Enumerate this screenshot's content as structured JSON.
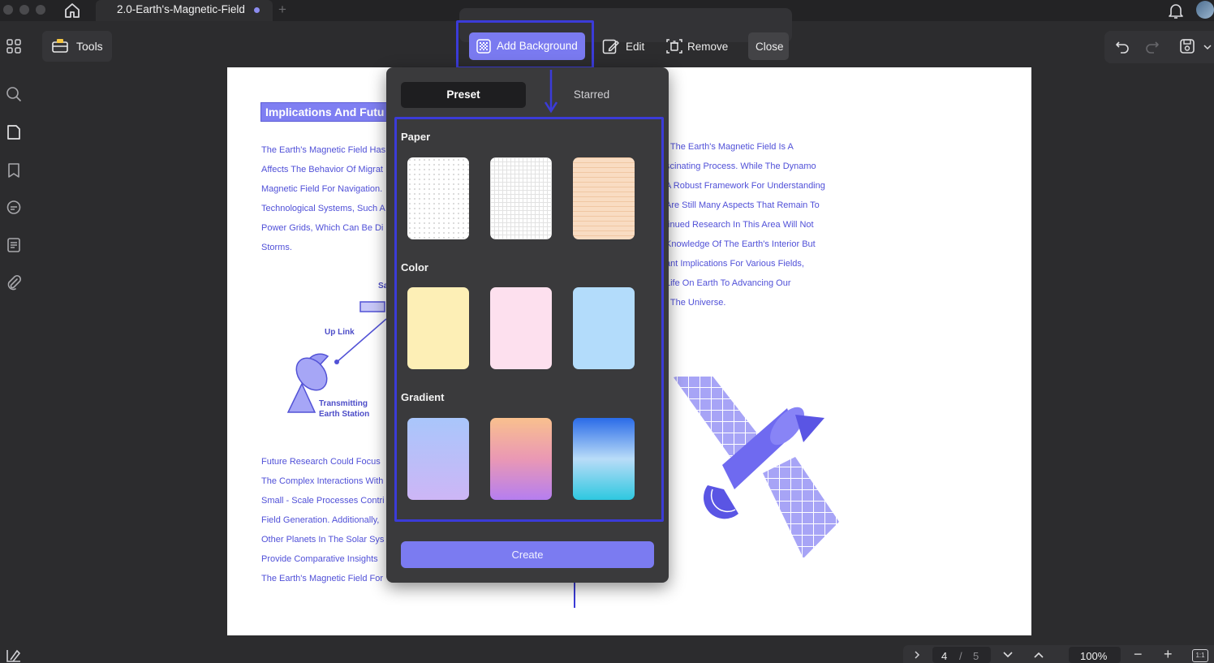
{
  "titlebar": {
    "tab_title": "2.0-Earth's-Magnetic-Field",
    "new_tab": "+"
  },
  "toolbar": {
    "tools_label": "Tools",
    "add_background_label": "Add Background",
    "edit_label": "Edit",
    "remove_label": "Remove",
    "close_label": "Close"
  },
  "document": {
    "heading": "Implications And Futu",
    "left_lines": [
      "The Earth's Magnetic Field Has",
      "Affects The Behavior Of Migrat",
      "Magnetic Field For Navigation.",
      "Technological Systems, Such A",
      "Power Grids, Which Can Be Di",
      "Storms."
    ],
    "right_lines": [
      "f The Earth's Magnetic Field Is A",
      "scinating Process. While The Dynamo",
      "A Robust Framework For Understanding",
      "Are Still Many Aspects That Remain To",
      "tinued Research In This Area Will Not",
      " Knowledge Of The Earth's Interior But",
      "ant Implications For Various Fields,",
      "Life On Earth To Advancing Our",
      "f The Universe."
    ],
    "lower_lines": [
      "Future Research Could Focus",
      "The Complex Interactions With",
      "Small - Scale Processes Contri",
      "Field Generation. Additionally,",
      "Other Planets In The Solar Sys",
      "Provide Comparative Insights",
      "The Earth's Magnetic Field For"
    ],
    "diagram": {
      "up_link": "Up Link",
      "station_line1": "Transmitting",
      "station_line2": "Earth Station",
      "sat_fragment": "Sa"
    }
  },
  "popover": {
    "tabs": [
      {
        "label": "Preset",
        "active": true
      },
      {
        "label": "Starred",
        "active": false
      }
    ],
    "sections": [
      {
        "label": "Paper",
        "swatches": [
          "dotted-paper",
          "grid-paper",
          "lined-peach-paper"
        ]
      },
      {
        "label": "Color",
        "swatches": [
          "#fdefb6",
          "#fde0ee",
          "#b3dcfb"
        ]
      },
      {
        "label": "Gradient",
        "swatches": [
          "blue-lavender",
          "peach-violet",
          "blue-cyan"
        ]
      }
    ],
    "create_label": "Create"
  },
  "pager": {
    "current_page": "4",
    "separator": "/",
    "total_pages": "5",
    "zoom": "100%",
    "fit_label": "1:1"
  },
  "colors": {
    "accent": "#7a7af0",
    "highlight": "#3b3bd8",
    "doc_text": "#5050d8"
  }
}
